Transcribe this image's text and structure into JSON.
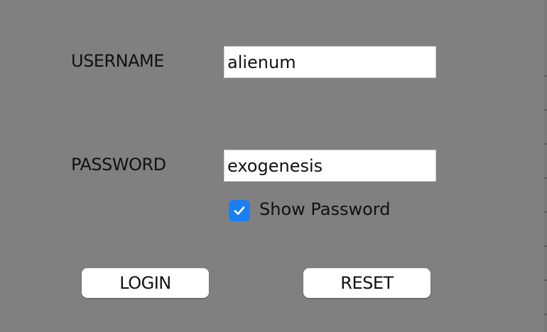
{
  "form": {
    "username_label": "USERNAME",
    "username_value": "alienum",
    "password_label": "PASSWORD",
    "password_value": "exogenesis",
    "show_password_label": "Show Password",
    "show_password_checked": true,
    "login_label": "LOGIN",
    "reset_label": "RESET"
  },
  "colors": {
    "background": "#808080",
    "checkbox_accent": "#1a7ff5",
    "field_background": "#ffffff",
    "text": "#111111"
  }
}
